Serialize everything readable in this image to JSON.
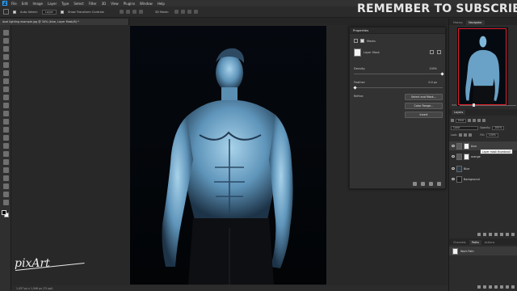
{
  "app": {
    "menus": [
      "File",
      "Edit",
      "Image",
      "Layer",
      "Type",
      "Select",
      "Filter",
      "3D",
      "View",
      "Plugins",
      "Window",
      "Help"
    ],
    "logo": "Ps"
  },
  "options_bar": {
    "auto_select_label": "Auto-Select:",
    "auto_select_value": "Layer",
    "show_transform_label": "Show Transform Controls",
    "mode_3d_label": "3D Mode:"
  },
  "overlay": {
    "subscribe_text": "REMEMBER TO SUBSCRIBE",
    "watermark": "pixArt"
  },
  "document": {
    "tab_title": "dual lighting example.jpg @ 34% (blue, Layer Mask/8) *",
    "status": "1,457 px x 1,946 px (72 ppi)"
  },
  "properties": {
    "title": "Properties",
    "masks_label": "Masks",
    "layer_mask_label": "Layer Mask",
    "density_label": "Density:",
    "density_value": "100%",
    "feather_label": "Feather:",
    "feather_value": "0.0 px",
    "refine_label": "Refine:",
    "buttons": [
      "Select and Mask...",
      "Color Range...",
      "Invert"
    ]
  },
  "navigator": {
    "tabs": [
      "History",
      "Navigator"
    ],
    "active_tab": "Navigator",
    "zoom": "34%"
  },
  "layers": {
    "tabs": [
      "Layers"
    ],
    "kind_label": "Kind",
    "blend_mode": "Color",
    "opacity_label": "Opacity:",
    "opacity_value": "100%",
    "lock_label": "Lock:",
    "fill_label": "Fill:",
    "fill_value": "100%",
    "items": [
      {
        "name": "blue",
        "selected": true
      },
      {
        "name": "orange",
        "selected": false
      },
      {
        "name": "Blue",
        "selected": false
      },
      {
        "name": "Background",
        "selected": false
      }
    ],
    "tooltip": "Layer mask thumbnail"
  },
  "paths": {
    "tabs": [
      "Channels",
      "Paths",
      "Actions"
    ],
    "active_tab": "Paths",
    "items": [
      {
        "name": "Work Path"
      }
    ]
  },
  "colors": {
    "accent_blue": "#31a8ff",
    "nav_frame": "#e4202c",
    "panel": "#323232",
    "figure_blue": "#7fb7d9"
  }
}
